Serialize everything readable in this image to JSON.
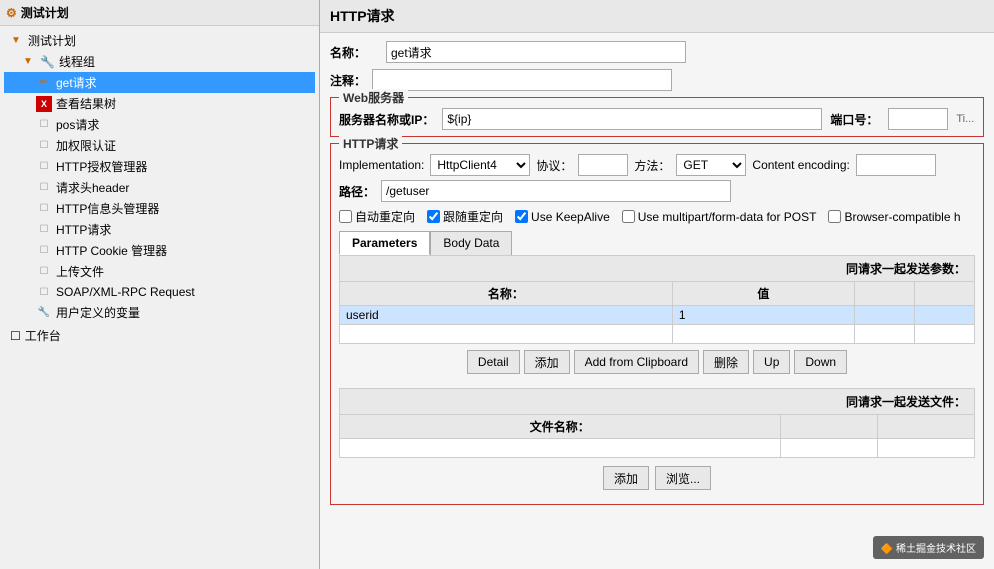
{
  "left": {
    "root": "测试计划",
    "tree": [
      {
        "id": "test-plan",
        "label": "测试计划",
        "indent": 0,
        "icon": "plan",
        "selected": false
      },
      {
        "id": "thread-group",
        "label": "线程组",
        "indent": 1,
        "icon": "thread",
        "selected": false
      },
      {
        "id": "get-request",
        "label": "get请求",
        "indent": 2,
        "icon": "sampler",
        "selected": true
      },
      {
        "id": "assertion-results",
        "label": "查看结果树",
        "indent": 2,
        "icon": "assertion",
        "selected": false
      },
      {
        "id": "pos-request",
        "label": "pos请求",
        "indent": 2,
        "icon": "sampler-gray",
        "selected": false
      },
      {
        "id": "auth",
        "label": "加权限认证",
        "indent": 2,
        "icon": "sampler-gray",
        "selected": false
      },
      {
        "id": "http-auth-manager",
        "label": "HTTP授权管理器",
        "indent": 2,
        "icon": "sampler-gray",
        "selected": false
      },
      {
        "id": "header-manager",
        "label": "请求头header",
        "indent": 2,
        "icon": "sampler-gray",
        "selected": false
      },
      {
        "id": "http-info-manager",
        "label": "HTTP信息头管理器",
        "indent": 2,
        "icon": "sampler-gray",
        "selected": false
      },
      {
        "id": "http-request",
        "label": "HTTP请求",
        "indent": 2,
        "icon": "sampler-gray",
        "selected": false
      },
      {
        "id": "cookie-manager",
        "label": "HTTP Cookie 管理器",
        "indent": 2,
        "icon": "sampler-gray",
        "selected": false
      },
      {
        "id": "upload-file",
        "label": "上传文件",
        "indent": 2,
        "icon": "sampler-gray",
        "selected": false
      },
      {
        "id": "soap-request",
        "label": "SOAP/XML-RPC Request",
        "indent": 2,
        "icon": "sampler-gray",
        "selected": false
      },
      {
        "id": "user-vars",
        "label": "用户定义的变量",
        "indent": 2,
        "icon": "red",
        "selected": false
      }
    ],
    "workbench": "工作台"
  },
  "right": {
    "title": "HTTP请求",
    "name_label": "名称：",
    "name_value": "get请求",
    "note_label": "注释：",
    "note_value": "",
    "web_server_section": "Web服务器",
    "server_label": "服务器名称或IP：",
    "server_value": "${ip}",
    "port_label": "端口号：",
    "port_value": "",
    "http_section": "HTTP请求",
    "impl_label": "Implementation:",
    "impl_value": "HttpClient4",
    "protocol_label": "协议：",
    "protocol_value": "",
    "method_label": "方法：",
    "method_value": "GET",
    "encoding_label": "Content encoding:",
    "encoding_value": "",
    "path_label": "路径：",
    "path_value": "/getuser",
    "auto_redirect": "自动重定向",
    "follow_redirect": "跟随重定向",
    "keep_alive": "Use KeepAlive",
    "multipart": "Use multipart/form-data for POST",
    "browser_compat": "Browser-compatible h",
    "tab_params": "Parameters",
    "tab_body": "Body Data",
    "params_title": "同请求一起发送参数：",
    "col_name": "名称：",
    "col_value": "值",
    "params": [
      {
        "name": "userid",
        "value": "1"
      }
    ],
    "btn_detail": "Detail",
    "btn_add": "添加",
    "btn_add_clipboard": "Add from Clipboard",
    "btn_delete": "删除",
    "btn_up": "Up",
    "btn_down": "Down",
    "file_section_title": "同请求一起发送文件：",
    "file_col": "文件名称：",
    "bottom_btn_add": "添加",
    "bottom_btn_browse": "浏览...",
    "watermark": "稀土掘金技术社区"
  }
}
